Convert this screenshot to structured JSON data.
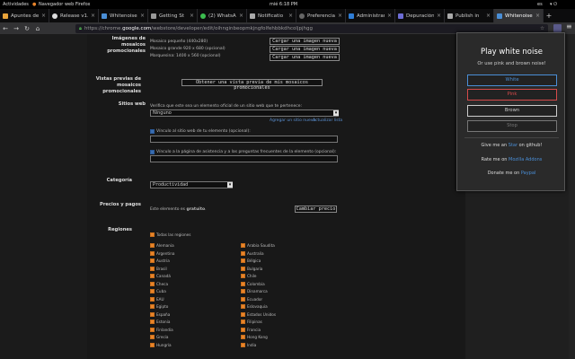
{
  "topbar": {
    "activities": "Actividades",
    "app": "Navegador web Firefox",
    "clock": "mié  6:18 PM",
    "lang": "es"
  },
  "tabs": [
    {
      "label": "Apuntes de",
      "color": "#e8a33a"
    },
    {
      "label": "Release v1.",
      "color": "#ddd"
    },
    {
      "label": "Whitenoise:",
      "color": "#4a8ed6"
    },
    {
      "label": "Getting St",
      "color": "#999"
    },
    {
      "label": "(2) WhatsAp",
      "color": "#3cbd4f"
    },
    {
      "label": "Notificatio",
      "color": "#aaa"
    },
    {
      "label": "Preferencia",
      "color": "#666"
    },
    {
      "label": "Administrar",
      "color": "#2e7dd6"
    },
    {
      "label": "Depuración",
      "color": "#6d6dd6"
    },
    {
      "label": "Publish in",
      "color": "#aaa"
    },
    {
      "label": "Whitenoise",
      "color": "#4a8ed6"
    }
  ],
  "nav": {
    "back": "←",
    "forward": "→",
    "reload": "↻",
    "home": "⌂",
    "url_pre": "https://chrome.",
    "url_domain": "google.com",
    "url_post": "/webstore/developer/edit/oihnginbeopmkjngfolfehbbkdhcoljpjhgg"
  },
  "page": {
    "promo_label": "Imágenes de mosaicos promocionales",
    "tile_small": "Mosaico pequeño (440x280)",
    "tile_large": "Mosaico grande 920 x 680 (opcional)",
    "tile_marquee": "Marquesina: 1400 x 560 (opcional)",
    "upload_btn": "Cargar una imagen nueva",
    "preview_label": "Vistas previas de mosaicos promocionales",
    "preview_btn": "Obtener una vista previa de mis mosaicos promocionales",
    "sites_label": "Sitios web",
    "sites_desc": "Verifica que este sea un elemento oficial de un sitio web que te pertenece:",
    "sites_value": "Ninguno",
    "add_site": "Agregar un sitio nuevo",
    "refresh": "Actualizar lista",
    "site_link_desc": "Vínculo al sitio web de tu elemento (opcional):",
    "support_desc": "Vínculo a la página de asistencia y a las preguntas frecuentes de la elemento (opcional):",
    "category_label": "Categoría",
    "category_value": "Productividad",
    "pricing_label": "Precios y pagos",
    "pricing_desc_pre": "Este elemento es",
    "pricing_desc_free": "gratuito",
    "change_price": "Cambiar precio",
    "regions_label": "Regiones",
    "all_regions": "Todas las regiones",
    "regions_left": [
      "Alemania",
      "Argentina",
      "Austria",
      "Brasil",
      "Canadá",
      "Checa",
      "Cuba",
      "EAU",
      "Egipto",
      "España",
      "Estonia",
      "Finlandia",
      "Grecia",
      "Hungría"
    ],
    "regions_right": [
      "Arabia Saudita",
      "Australia",
      "Bélgica",
      "Bulgaria",
      "Chile",
      "Colombia",
      "Dinamarca",
      "Ecuador",
      "Eslovaquia",
      "Estados Unidos",
      "Filipinas",
      "Francia",
      "Hong Kong",
      "India"
    ]
  },
  "popup": {
    "title": "Play white noise",
    "subtitle": "Or use pink and brown noise!",
    "btn_white": "White",
    "btn_pink": "Pink",
    "btn_brown": "Brown",
    "btn_stop": "Stop",
    "star_pre": "Give me an",
    "star_link": "Star",
    "star_post": "on github!",
    "rate_pre": "Rate me on",
    "rate_link": "Mozilla Addons",
    "donate_pre": "Donate me on",
    "donate_link": "Paypal",
    "colors": {
      "white": "#4a8ed6",
      "pink": "#d64a4a",
      "brown": "#cccccc",
      "stop": "#777777"
    }
  }
}
